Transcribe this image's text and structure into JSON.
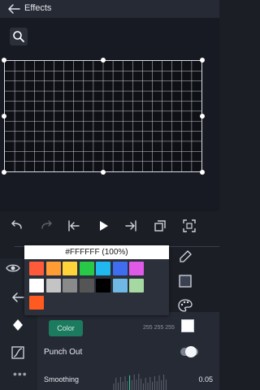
{
  "app": {
    "title": "Effects"
  },
  "color_picker": {
    "hex_value": "#FFFFFF (100%)",
    "swatches": [
      [
        "#ff5a3a",
        "#ff9d34",
        "#ffd43b",
        "#27c947",
        "#1fb8ef",
        "#3f6df0",
        "#e05ae8"
      ],
      [
        "#ffffff",
        "#c4c4c4",
        "#8a8a8a",
        "#555555",
        "#000000",
        "#6fb8e3",
        "#a6d9a1"
      ],
      [
        "#ff5a20"
      ]
    ]
  },
  "properties": {
    "color_button_label": "Color",
    "rgb_readout": "255 255 255",
    "current_color": "#ffffff",
    "punch_out_label": "Punch Out",
    "punch_out_enabled": false,
    "smoothing_label": "Smoothing",
    "smoothing_value": "0.05"
  },
  "colors": {
    "accent_green": "#1c7a5e",
    "panel": "#262a34",
    "background": "#1c1e26"
  }
}
